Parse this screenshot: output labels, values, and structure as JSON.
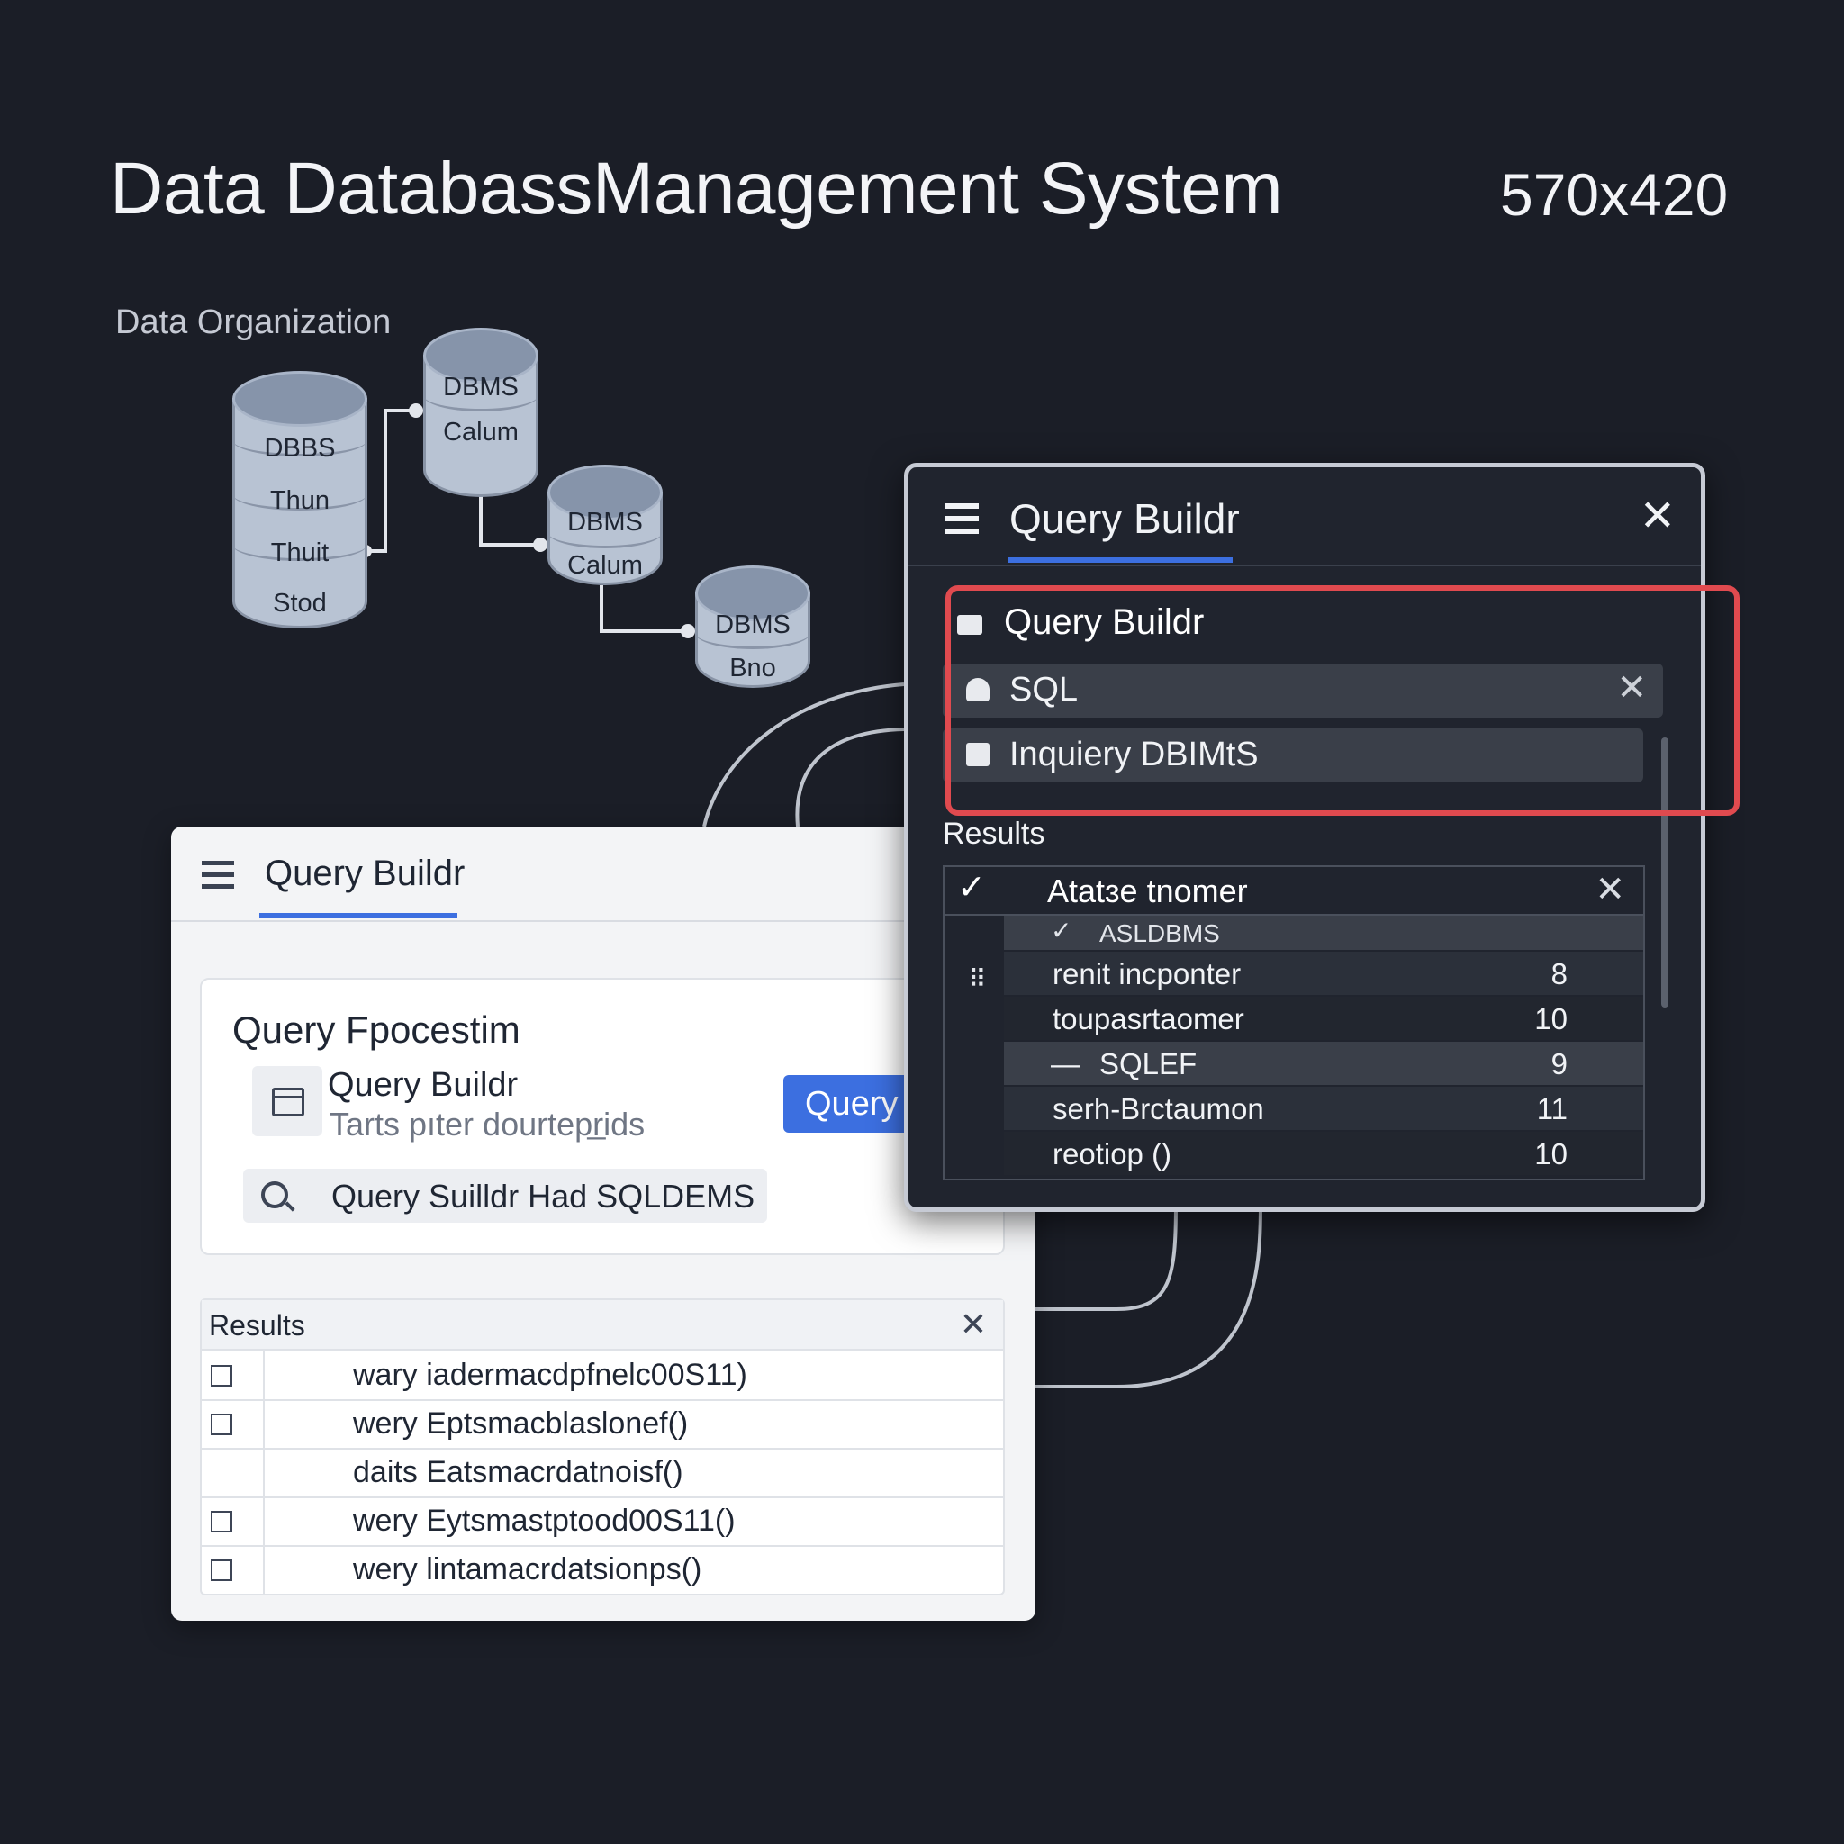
{
  "header": {
    "title": "Data DatabassManagement System",
    "dims": "570x420"
  },
  "diagram": {
    "label": "Data Organization",
    "cyl_main": [
      "DBBS",
      "Thun",
      "Thuit",
      "Stod"
    ],
    "cyl_a": [
      "DBMS",
      "Calum"
    ],
    "cyl_b": [
      "DBMS",
      "Calum"
    ],
    "cyl_c": [
      "DBMS",
      "Bno"
    ]
  },
  "left_panel": {
    "title": "Query Buildr",
    "card": {
      "heading": "Query Fpocestim",
      "item_title": "Query Buildr",
      "item_sub": "Tarts pıter dourtepr̲ids",
      "button": "Query",
      "search": "Query Suilldr Had SQLDEMS"
    },
    "results": {
      "label": "Results",
      "rows": [
        {
          "text": "wary iadermacdpfnelc00S11)",
          "checkbox": true
        },
        {
          "text": "wery Eptsmacblaslonef()",
          "checkbox": true
        },
        {
          "text": "daits Eatsmacrdatnoisf()",
          "checkbox": false
        },
        {
          "text": "wery Eytsmastptood00S11()",
          "checkbox": true
        },
        {
          "text": "wery lintamacrdatsionps()",
          "checkbox": true
        }
      ]
    }
  },
  "right_panel": {
    "title": "Query Buildr",
    "section_title": "Query Buildr",
    "sql_label": "SQL",
    "inquery_label": "Inquiery DBIMtS",
    "results_label": "Results",
    "table": {
      "header": "Atatɜe tnomer",
      "sub": "ASLDBMS",
      "rows": [
        {
          "name": "renit incponter",
          "value": "8"
        },
        {
          "name": "toupasrtaomer",
          "value": "10"
        },
        {
          "name": "SQLEF",
          "value": "9"
        },
        {
          "name": "serh-Brctaumon",
          "value": "11"
        },
        {
          "name": "reotiop ()",
          "value": "10"
        }
      ]
    }
  },
  "colors": {
    "background": "#1b1e27",
    "accent": "#3c6fe0",
    "highlight": "#e04a4f"
  }
}
